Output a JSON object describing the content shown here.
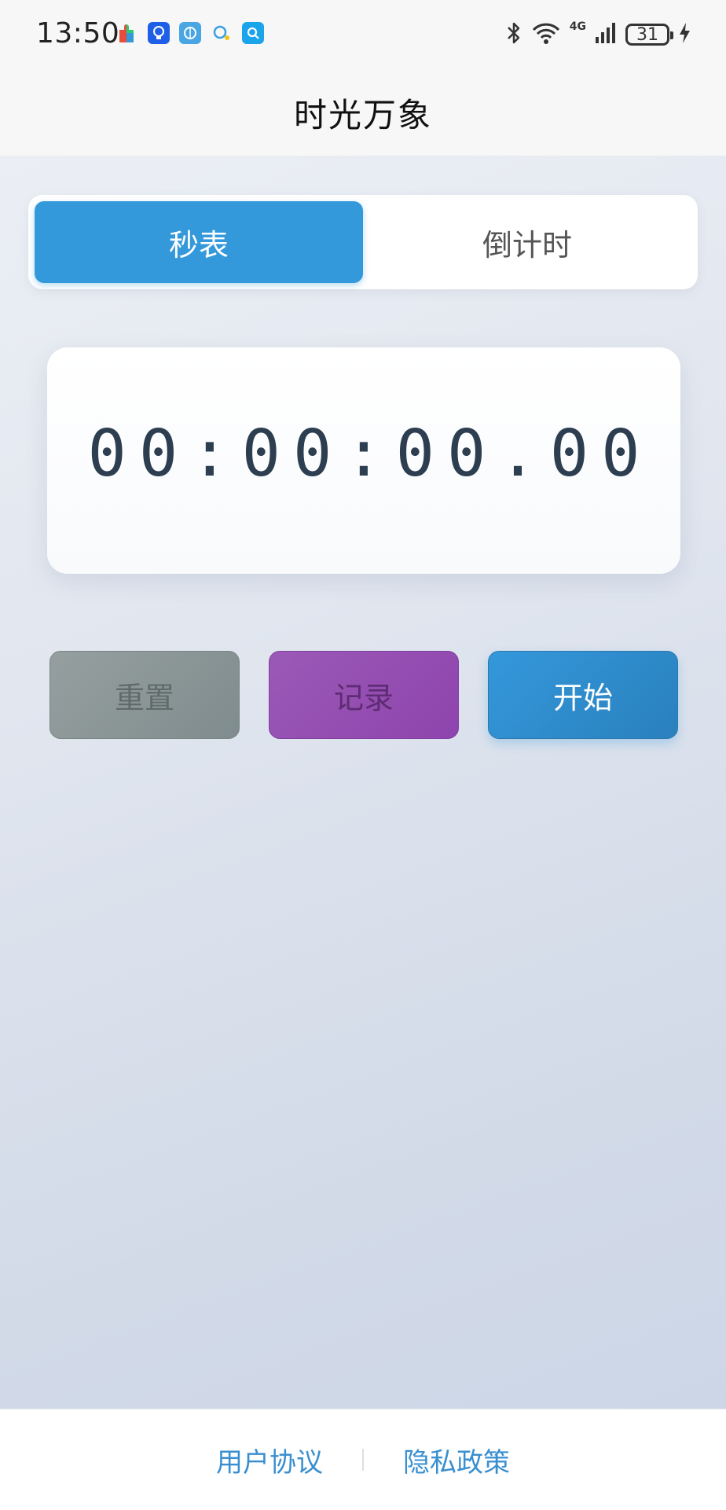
{
  "status_bar": {
    "time": "13:50",
    "network": "4G",
    "battery": "31",
    "app_icons": [
      "puzzle-app-icon",
      "bulb-app-icon",
      "globe-app-icon",
      "cloud-app-icon",
      "search-app-icon"
    ]
  },
  "header": {
    "title": "时光万象"
  },
  "mode_tabs": [
    {
      "label": "秒表",
      "active": true
    },
    {
      "label": "倒计时",
      "active": false
    }
  ],
  "timer": {
    "display": "00:00:00.00"
  },
  "controls": {
    "reset_label": "重置",
    "lap_label": "记录",
    "start_label": "开始"
  },
  "footer": {
    "terms_label": "用户协议",
    "privacy_label": "隐私政策"
  },
  "colors": {
    "accent": "#3499db",
    "reset": "#7f8c8d",
    "lap": "#9b59b6",
    "start": "#3498db",
    "timer_text": "#2c3e50",
    "link": "#3a8fd0"
  }
}
